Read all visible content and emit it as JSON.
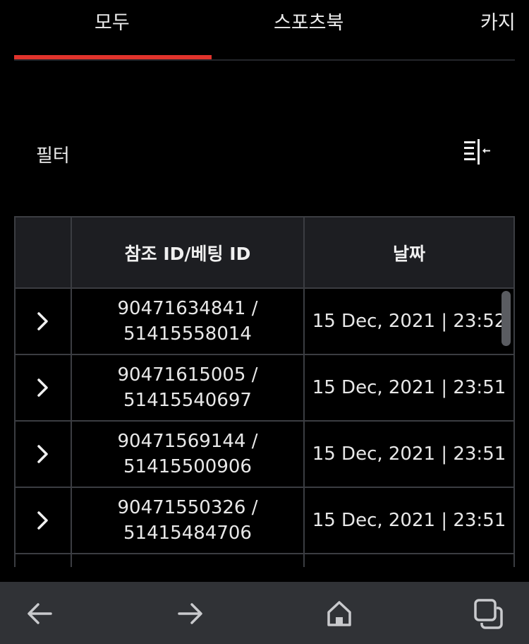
{
  "tabs": [
    {
      "label": "모두",
      "active": true
    },
    {
      "label": "스포츠북",
      "active": false
    },
    {
      "label": "카지"
    }
  ],
  "colors": {
    "accent": "#e1332c",
    "background": "#000000",
    "header_bg": "#1d1e22",
    "border": "#3b3d42",
    "nav_bar": "#303236"
  },
  "filter": {
    "label": "필터",
    "icon": "filter-collapse-icon"
  },
  "table": {
    "columns": [
      "",
      "참조 ID/베팅 ID",
      "날짜"
    ],
    "rows": [
      {
        "ref_id": "90471634841 /",
        "bet_id": "51415558014",
        "date": "15 Dec, 2021 | 23:52"
      },
      {
        "ref_id": "90471615005 /",
        "bet_id": "51415540697",
        "date": "15 Dec, 2021 | 23:51"
      },
      {
        "ref_id": "90471569144 /",
        "bet_id": "51415500906",
        "date": "15 Dec, 2021 | 23:51"
      },
      {
        "ref_id": "90471550326 /",
        "bet_id": "51415484706",
        "date": "15 Dec, 2021 | 23:51"
      }
    ]
  },
  "bottom_nav": {
    "icons": [
      "back-arrow-icon",
      "forward-arrow-icon",
      "home-icon",
      "tabs-icon"
    ]
  }
}
